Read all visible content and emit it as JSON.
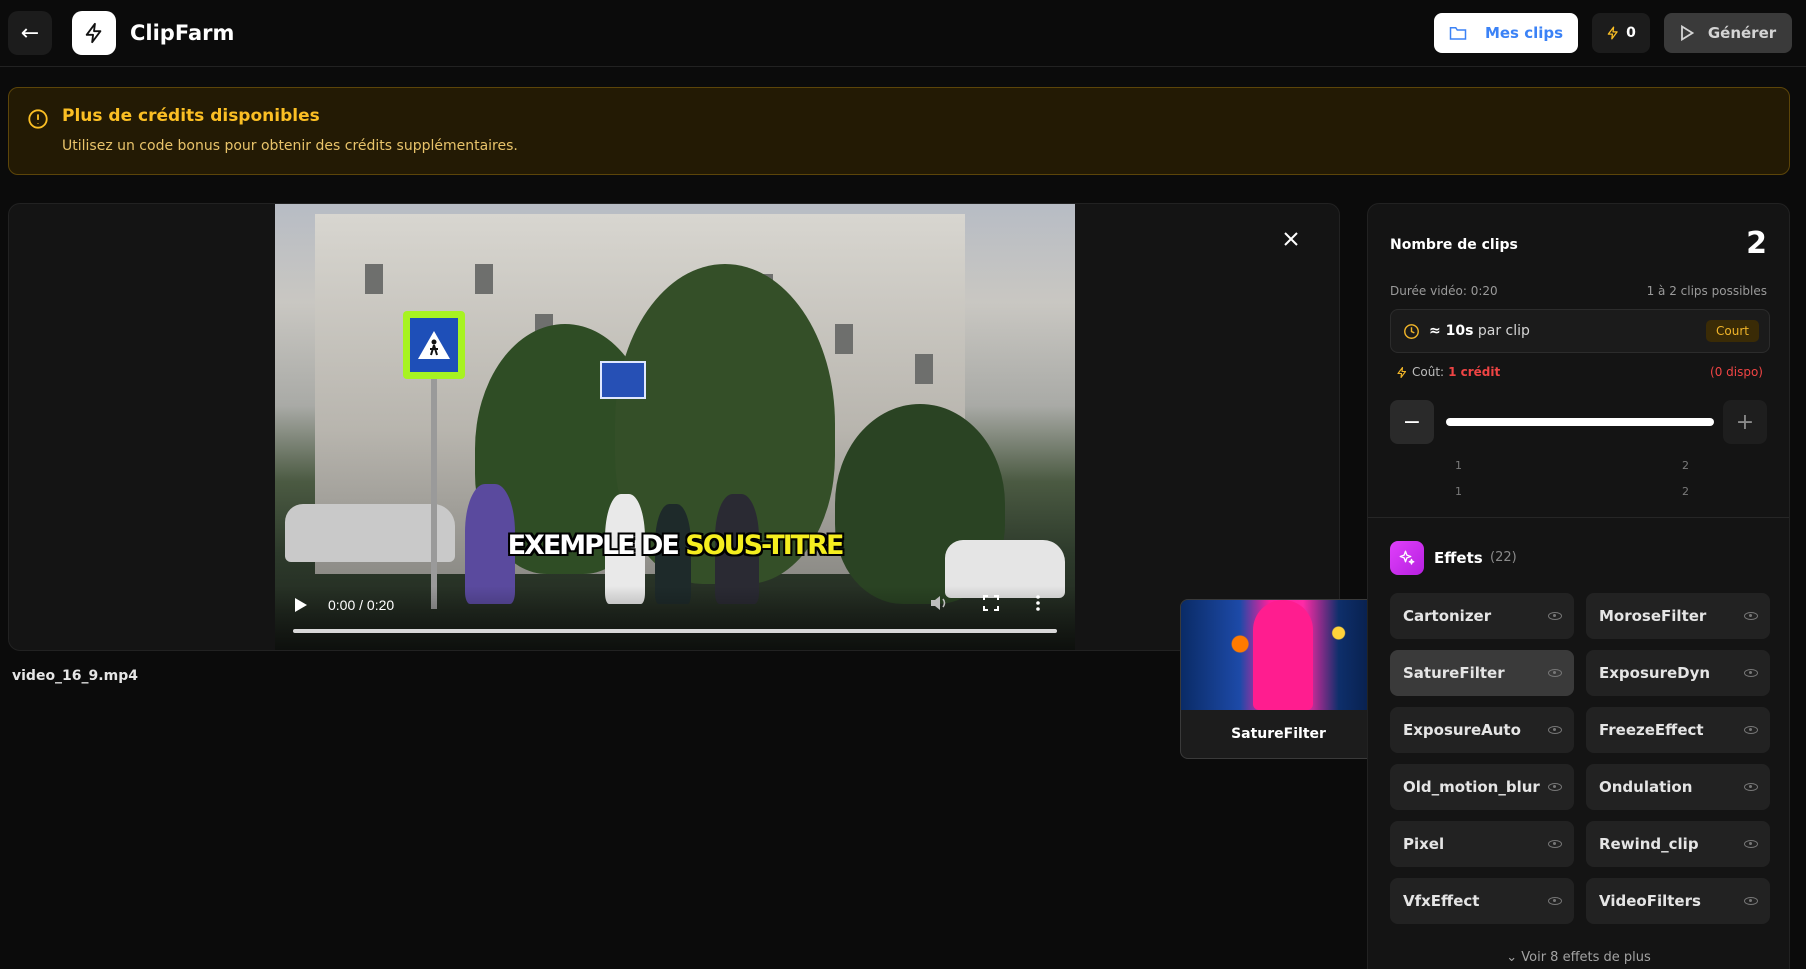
{
  "header": {
    "app_title": "ClipFarm",
    "my_clips_label": "Mes clips",
    "credits_count": "0",
    "generate_label": "Générer"
  },
  "banner": {
    "title": "Plus de crédits disponibles",
    "subtitle": "Utilisez un code bonus pour obtenir des crédits supplémentaires."
  },
  "video": {
    "subtitle_prefix": "EXEMPLE DE ",
    "subtitle_highlight": "SOUS-TITRE",
    "time_display": "0:00 / 0:20",
    "filename": "video_16_9.mp4"
  },
  "preview": {
    "label": "SatureFilter"
  },
  "sidebar": {
    "clips_label": "Nombre de clips",
    "clips_count": "2",
    "duration_text": "Durée vidéo: 0:20",
    "possible_text": "1 à 2 clips possibles",
    "per_clip_value": "≈ 10s",
    "per_clip_suffix": " par clip",
    "badge": "Court",
    "cost_label": "Coût:",
    "cost_value": "1 crédit",
    "available": "(0 dispo)",
    "slider_min": "1",
    "slider_max": "2",
    "slider_min_2": "1",
    "slider_max_2": "2",
    "effects_title": "Effets",
    "effects_count": "(22)",
    "effects": [
      {
        "name": "Cartonizer"
      },
      {
        "name": "MoroseFilter"
      },
      {
        "name": "SatureFilter"
      },
      {
        "name": "ExposureDyn"
      },
      {
        "name": "ExposureAuto"
      },
      {
        "name": "FreezeEffect"
      },
      {
        "name": "Old_motion_blur"
      },
      {
        "name": "Ondulation"
      },
      {
        "name": "Pixel"
      },
      {
        "name": "Rewind_clip"
      },
      {
        "name": "VfxEffect"
      },
      {
        "name": "VideoFilters"
      }
    ],
    "more_label": "Voir 8 effets de plus"
  },
  "colors": {
    "accent_blue": "#3b82f6",
    "warning": "#fbbf24",
    "error": "#ef4444",
    "effects_icon": "#d946ef"
  }
}
